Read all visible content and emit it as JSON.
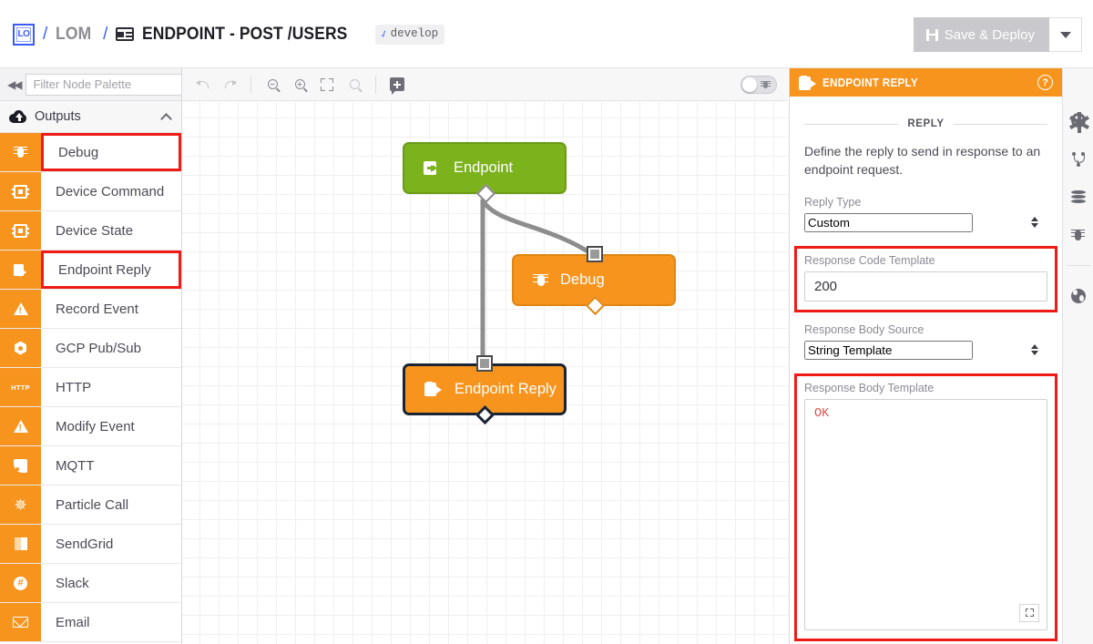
{
  "header": {
    "logo_text": "LO",
    "separator": "/",
    "org": "LOM",
    "title": "ENDPOINT - POST /USERS",
    "branch": "develop",
    "branch_icon": "branch-icon",
    "flow_icon": "flow-icon",
    "save_deploy_label": "Save & Deploy",
    "save_icon": "save-disk-icon",
    "caret_icon": "chevron-down-icon"
  },
  "palette": {
    "collapse_icon": "collapse-left-icon",
    "filter_placeholder": "Filter Node Palette",
    "filter_value": "",
    "group_label": "Outputs",
    "group_icon": "cloud-upload-icon",
    "group_chevron": "chevron-up-icon",
    "items": [
      {
        "label": "Debug",
        "icon": "bug-icon",
        "highlighted": true
      },
      {
        "label": "Device Command",
        "icon": "chip-command-icon",
        "highlighted": false
      },
      {
        "label": "Device State",
        "icon": "chip-state-icon",
        "highlighted": false
      },
      {
        "label": "Endpoint Reply",
        "icon": "clipboard-reply-icon",
        "highlighted": true
      },
      {
        "label": "Record Event",
        "icon": "warning-plus-icon",
        "highlighted": false
      },
      {
        "label": "GCP Pub/Sub",
        "icon": "gcp-pubsub-icon",
        "highlighted": false
      },
      {
        "label": "HTTP",
        "icon": "http-icon",
        "highlighted": false
      },
      {
        "label": "Modify Event",
        "icon": "modify-event-icon",
        "highlighted": false
      },
      {
        "label": "MQTT",
        "icon": "mqtt-icon",
        "highlighted": false
      },
      {
        "label": "Particle Call",
        "icon": "particle-icon",
        "highlighted": false
      },
      {
        "label": "SendGrid",
        "icon": "sendgrid-icon",
        "highlighted": false
      },
      {
        "label": "Slack",
        "icon": "slack-icon",
        "highlighted": false
      },
      {
        "label": "Email",
        "icon": "mail-icon",
        "highlighted": false
      }
    ]
  },
  "canvas": {
    "toolbar": {
      "undo_icon": "undo-icon",
      "redo_icon": "redo-icon",
      "zoom_out_icon": "zoom-out-icon",
      "zoom_in_icon": "zoom-in-icon",
      "fit_icon": "fit-to-screen-icon",
      "zoom_reset_icon": "zoom-reset-icon",
      "add_note_icon": "add-note-icon",
      "debug_toggle_icon": "debug-toggle-icon",
      "debug_toggle_state": "off"
    },
    "nodes": [
      {
        "label": "Endpoint",
        "icon": "endpoint-icon",
        "color": "#7cb21c",
        "selected": false
      },
      {
        "label": "Debug",
        "icon": "bug-icon",
        "color": "#f7941e",
        "selected": false
      },
      {
        "label": "Endpoint Reply",
        "icon": "endpoint-reply-icon",
        "color": "#f7941e",
        "selected": true
      }
    ]
  },
  "inspector": {
    "title": "ENDPOINT REPLY",
    "title_icon": "clipboard-reply-icon",
    "help_icon": "help-circle-icon",
    "help_label": "?",
    "section_label": "REPLY",
    "description": "Define the reply to send in response to an endpoint request.",
    "fields": {
      "reply_type": {
        "label": "Reply Type",
        "value": "Custom",
        "options": [
          "Custom"
        ],
        "highlighted": false
      },
      "response_code_template": {
        "label": "Response Code Template",
        "value": "200",
        "highlighted": true
      },
      "response_body_source": {
        "label": "Response Body Source",
        "value": "String Template",
        "options": [
          "String Template"
        ],
        "highlighted": false
      },
      "response_body_template": {
        "label": "Response Body Template",
        "value": "OK",
        "highlighted": true,
        "expand_icon": "expand-editor-icon"
      }
    },
    "highlight_color": "#ee1b17"
  },
  "rail": {
    "items": [
      {
        "icon": "gear-icon"
      },
      {
        "icon": "version-branch-icon"
      },
      {
        "icon": "data-table-icon"
      },
      {
        "icon": "bug-icon"
      },
      {
        "icon": "globe-icon"
      }
    ]
  }
}
